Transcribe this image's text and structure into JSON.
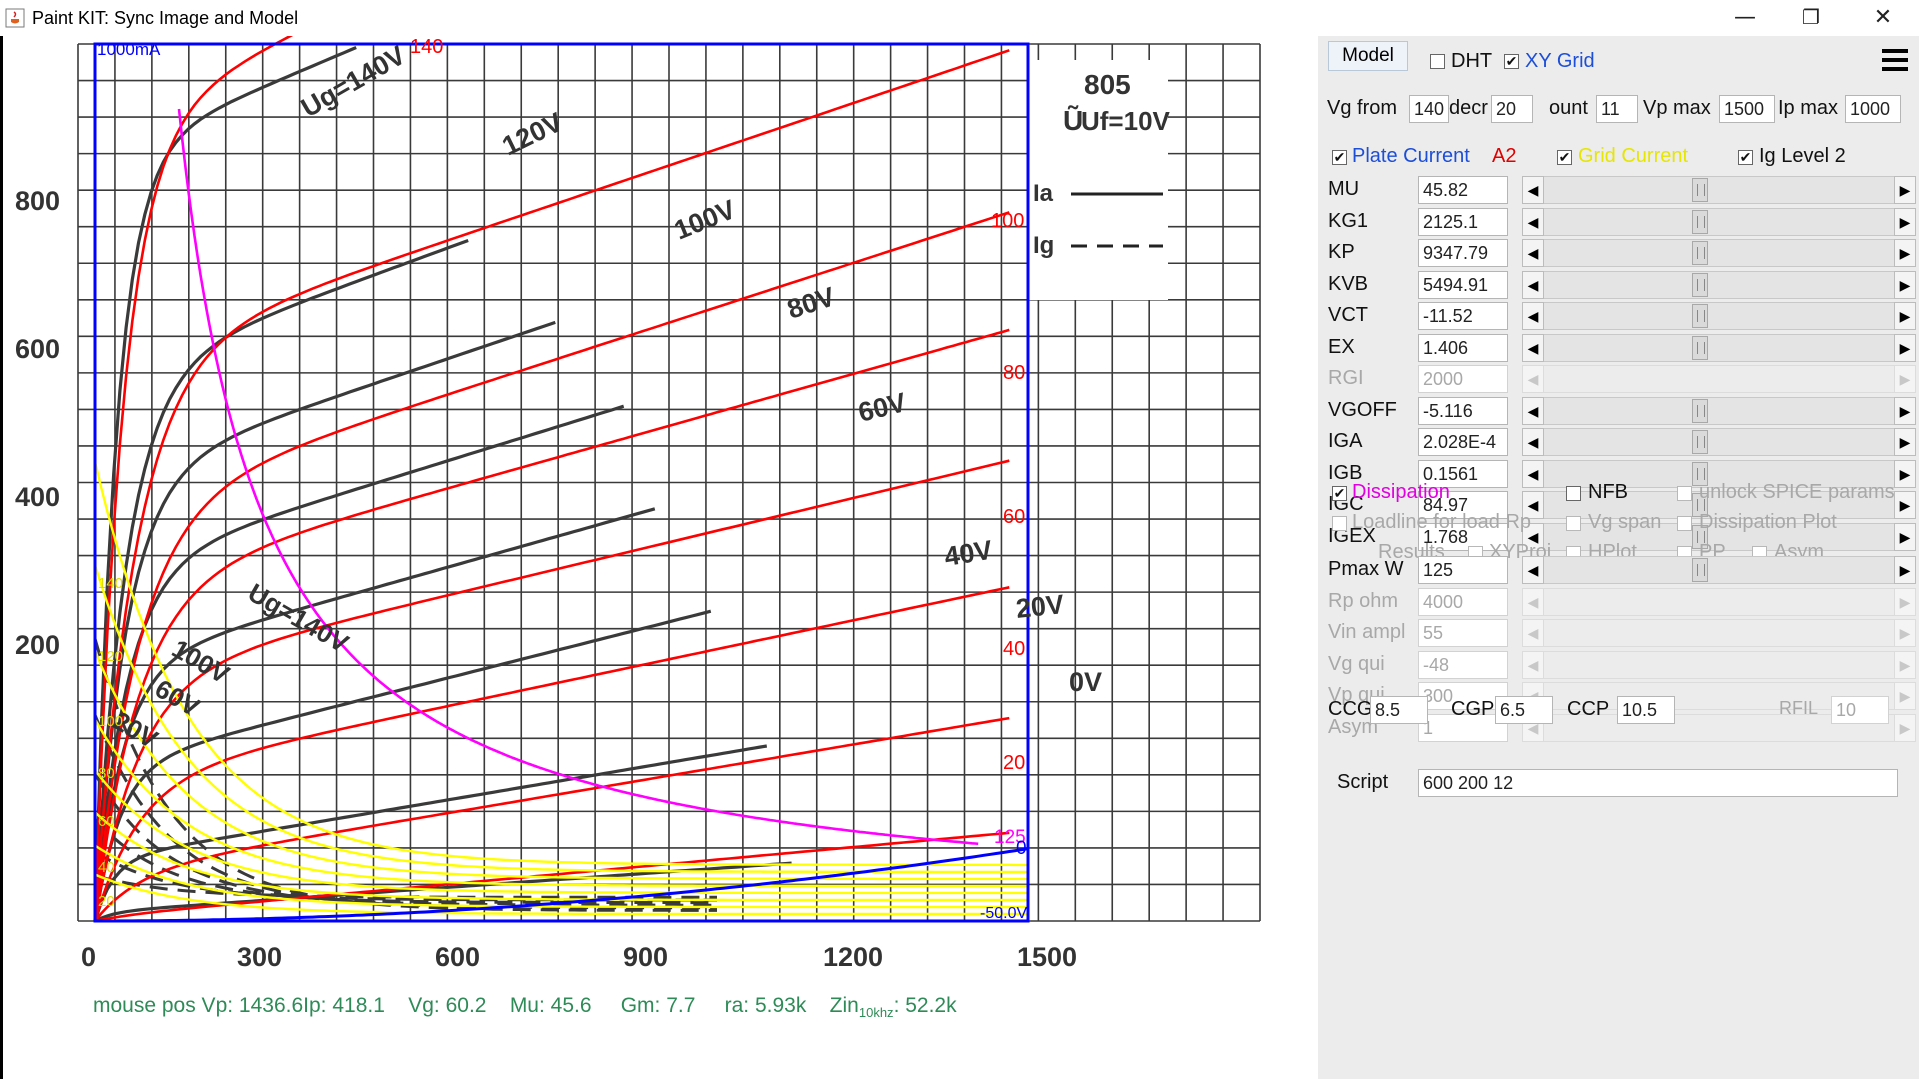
{
  "window": {
    "title": "Paint KIT: Sync Image and Model",
    "minimize": "—",
    "restore": "❐",
    "close": "✕"
  },
  "plot": {
    "tube_name": "805",
    "heater": "Uf=10V",
    "legend_ia": "Ia",
    "legend_ig": "Ig",
    "y_max_label": "1000mA",
    "y_ticks": [
      "800",
      "600",
      "400",
      "200"
    ],
    "x_ticks": [
      "0",
      "300",
      "600",
      "900",
      "1200",
      "1500"
    ],
    "black_curve_labels": [
      "Ug=140V",
      "120V",
      "100V",
      "80V",
      "60V",
      "40V",
      "20V",
      "0V"
    ],
    "grid_curve_labels": [
      "Ug=140V",
      "100V",
      "60V",
      "20V"
    ],
    "red_labels": [
      "140",
      "100",
      "80",
      "60",
      "40",
      "20"
    ],
    "pink_label": "125",
    "blue_labels": [
      "0",
      "-50.0V"
    ],
    "yellow_labels": [
      "140",
      "120",
      "100",
      "80",
      "60",
      "40",
      "20"
    ],
    "status": {
      "mouse_pos": "mouse pos Vp: 1436.6",
      "ip": "Ip: 418.1",
      "vg": "Vg: 60.2",
      "mu": "Mu: 45.6",
      "gm": "Gm: 7.7",
      "ra": "ra: 5.93k",
      "zin_prefix": "Zin",
      "zin_sub": "10khz",
      "zin_value": ": 52.2k"
    },
    "colors": {
      "grid": "#3a3a3a",
      "plate_model": "#ff0000",
      "grid_model": "#ffff00",
      "dissipation": "#ff00ff",
      "frame": "#0000ff",
      "status": "#2e8b57"
    }
  },
  "panel": {
    "model_button": "Model",
    "dht_label": "DHT",
    "xygrid_label": "XY Grid",
    "vg_from_label": "Vg from",
    "vg_from": "140",
    "decr_label": "decr",
    "decr": "20",
    "count_label": "ount",
    "count": "11",
    "vpmax_label": "Vp max",
    "vpmax": "1500",
    "ipmax_label": "Ip max",
    "ipmax": "1000",
    "plate_current_label": "Plate Current",
    "plate_current_mode": "A2",
    "grid_current_label": "Grid Current",
    "ig_level_label": "Ig Level 2",
    "params": [
      {
        "name": "MU",
        "value": "45.82",
        "enabled": true
      },
      {
        "name": "KG1",
        "value": "2125.1",
        "enabled": true
      },
      {
        "name": "KP",
        "value": "9347.79",
        "enabled": true
      },
      {
        "name": "KVB",
        "value": "5494.91",
        "enabled": true
      },
      {
        "name": "VCT",
        "value": "-11.52",
        "enabled": true
      },
      {
        "name": "EX",
        "value": "1.406",
        "enabled": true
      },
      {
        "name": "RGI",
        "value": "2000",
        "enabled": false
      },
      {
        "name": "VGOFF",
        "value": "-5.116",
        "enabled": true
      },
      {
        "name": "IGA",
        "value": "2.028E-4",
        "enabled": true
      },
      {
        "name": "IGB",
        "value": "0.1561",
        "enabled": true
      },
      {
        "name": "IGC",
        "value": "84.97",
        "enabled": true
      },
      {
        "name": "IGEX",
        "value": "1.768",
        "enabled": true
      }
    ],
    "dissipation_label": "Dissipation",
    "nfb_label": "NFB",
    "unlock_spice_label": "unlock SPICE params",
    "loadline_label": "Loadline for load Rp",
    "vg_span_label": "Vg span",
    "dissipation_plot_label": "Dissipation Plot",
    "results_label": "Results",
    "xyproj_label": "XYProj",
    "hplot_label": "HPlot",
    "pp_label": "PP",
    "asym_check_label": "Asym",
    "params2": [
      {
        "name": "Pmax W",
        "value": "125",
        "enabled": true
      },
      {
        "name": "Rp ohm",
        "value": "4000",
        "enabled": false
      },
      {
        "name": "Vin ampl",
        "value": "55",
        "enabled": false
      },
      {
        "name": "Vg qui",
        "value": "-48",
        "enabled": false
      },
      {
        "name": "Vp qui",
        "value": "300",
        "enabled": false
      },
      {
        "name": "Asym",
        "value": "1",
        "enabled": false
      }
    ],
    "ccg_label": "CCG",
    "ccg": "8.5",
    "cgp_label": "CGP",
    "cgp": "6.5",
    "ccp_label": "CCP",
    "ccp": "10.5",
    "rfil_label": "RFIL",
    "rfil": "10",
    "script_label": "Script",
    "script": "600 200 12",
    "colors": {
      "plate_current": "#1d4ed8",
      "mode": "#e00000",
      "grid_current": "#e6e600",
      "dissipation": "#e000e0",
      "disabled": "#a8a8a8"
    }
  }
}
